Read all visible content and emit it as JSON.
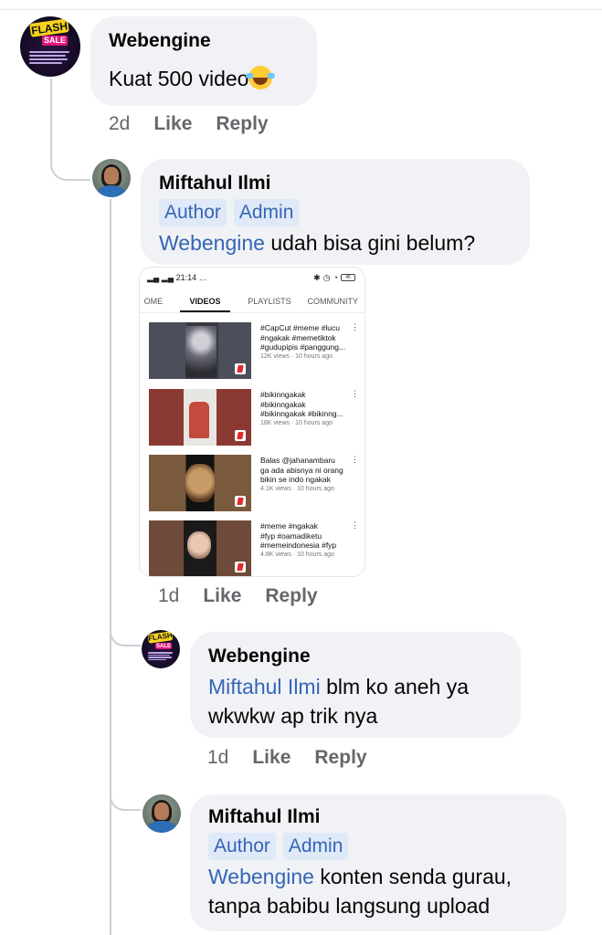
{
  "comments": [
    {
      "author": "Webengine",
      "text": "Kuat 500 video",
      "emoji": "rolling-on-floor-laughing",
      "time": "2d",
      "like_label": "Like",
      "reply_label": "Reply"
    },
    {
      "author": "Miftahul Ilmi",
      "badges": [
        "Author",
        "Admin"
      ],
      "mention": "Webengine",
      "text": " udah bisa gini belum?",
      "time": "1d",
      "like_label": "Like",
      "reply_label": "Reply"
    },
    {
      "author": "Webengine",
      "mention": "Miftahul Ilmi",
      "text_line1": " blm ko aneh ya",
      "text_line2": "wkwkw ap trik nya",
      "time": "1d",
      "like_label": "Like",
      "reply_label": "Reply"
    },
    {
      "author": "Miftahul Ilmi",
      "badges": [
        "Author",
        "Admin"
      ],
      "mention": "Webengine",
      "text_line1": " konten senda gurau,",
      "text_line2": "tanpa babibu langsung upload"
    }
  ],
  "avatar_flash": {
    "badge": "FLASH",
    "sale": "SALE"
  },
  "screenshot": {
    "status_time": "21:14",
    "status_left": "…",
    "battery": "45",
    "tabs": [
      "OME",
      "VIDEOS",
      "PLAYLISTS",
      "COMMUNITY"
    ],
    "active_tab": "VIDEOS",
    "videos": [
      {
        "title_lines": [
          "#CapCut #meme #lucu",
          "#ngakak #memetiktok",
          "#gudupipis #panggung..."
        ],
        "meta": "12K views · 10 hours ago"
      },
      {
        "title_lines": [
          "#bikinngakak",
          "#bikinngakak",
          "#bikinngakak #bikinng..."
        ],
        "meta": "18K views · 10 hours ago"
      },
      {
        "title_lines": [
          "Balas @jahanambaru",
          "ga ada abisnya ni orang",
          "bikin se indo ngakak"
        ],
        "meta": "4.1K views · 10 hours ago"
      },
      {
        "title_lines": [
          "#meme #ngakak",
          "#fyp #oamadiketu",
          "#memeindonesia #fyp"
        ],
        "meta": "4.8K views · 10 hours ago"
      }
    ]
  },
  "colors": {
    "bubble": "#f0f2f5",
    "mention": "#3565b5",
    "badge_bg": "#dfe9f8",
    "meta_text": "#65676b"
  }
}
